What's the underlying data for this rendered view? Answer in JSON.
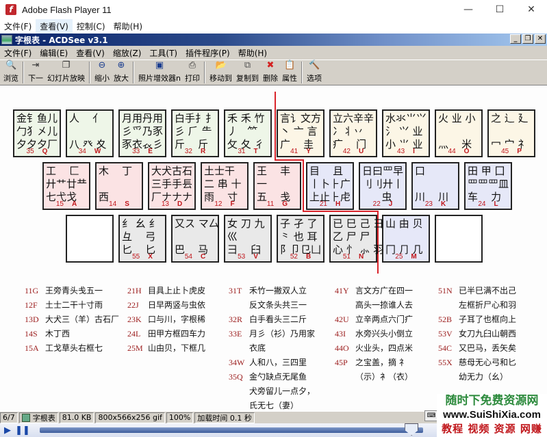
{
  "outer_window": {
    "title": "Adobe Flash Player 11",
    "menu": [
      "文件(F)",
      "查看(V)",
      "控制(C)",
      "帮助(H)"
    ],
    "active_menu_index": 1,
    "controls": {
      "minimize": "—",
      "maximize": "☐",
      "close": "✕"
    }
  },
  "acdsee": {
    "title": "字根表 - ACDSee v3.1",
    "mdi_buttons": {
      "minimize": "_",
      "restore": "❐",
      "close": "✕"
    },
    "menu": [
      "文件(F)",
      "编辑(E)",
      "查看(V)",
      "缩放(Z)",
      "工具(T)",
      "插件程序(P)",
      "帮助(H)"
    ],
    "toolbar": [
      {
        "label": "浏览",
        "icon": "🔍",
        "color": "#c9a227"
      },
      {
        "sep": true
      },
      {
        "label": "下一",
        "icon": "⇥",
        "color": "#333"
      },
      {
        "label": "幻灯片放映",
        "icon": "❐",
        "color": "#333"
      },
      {
        "sep": true
      },
      {
        "label": "缩小",
        "icon": "⊖",
        "color": "#1a3d8f"
      },
      {
        "label": "放大",
        "icon": "⊕",
        "color": "#1a3d8f"
      },
      {
        "sep": true
      },
      {
        "label": "照片增效器n",
        "icon": "▣",
        "color": "#1a3d8f"
      },
      {
        "label": "打印",
        "icon": "⎙",
        "color": "#333"
      },
      {
        "sep": true
      },
      {
        "label": "移动到",
        "icon": "📂",
        "color": "#c9a227"
      },
      {
        "label": "复制到",
        "icon": "⧉",
        "color": "#555"
      },
      {
        "label": "删除",
        "icon": "✖",
        "color": "#d42020"
      },
      {
        "label": "属性",
        "icon": "📋",
        "color": "#333"
      },
      {
        "sep": true
      },
      {
        "label": "选项",
        "icon": "🔨",
        "color": "#333"
      }
    ]
  },
  "keyboard": {
    "row1": [
      {
        "key": "Q",
        "num": "35",
        "color": "green",
        "glyphs": "金钅鱼儿\n勹犭㐅儿\n夕夕夕厂"
      },
      {
        "key": "W",
        "num": "34",
        "color": "green",
        "glyphs": "人    亻\n\n八 癶 夊"
      },
      {
        "key": "E",
        "num": "33",
        "color": "green",
        "glyphs": "月用丹用\n彡爫乃豕\n豕衣𧘇彡"
      },
      {
        "key": "R",
        "num": "32",
        "color": "green",
        "glyphs": "白手扌扌\n彡 ⺁ ⺧\n斤    斤"
      },
      {
        "key": "T",
        "num": "31",
        "color": "green",
        "glyphs": "禾 禾 竹\n丿   ⺮\n攵 夂 彳"
      },
      {
        "key": "Y",
        "num": "41",
        "color": "yellow",
        "glyphs": "言讠文方\n丶 亠 ⾔\n广    圭"
      },
      {
        "key": "U",
        "num": "42",
        "color": "yellow",
        "glyphs": "立六辛辛\n冫丬丷\n疒    门"
      },
      {
        "key": "I",
        "num": "43",
        "color": "yellow",
        "glyphs": "水氺⺌⺍\n氵 ⺍ 业\n小 ⺌ 业"
      },
      {
        "key": "O",
        "num": "44",
        "color": "yellow",
        "glyphs": "火 业 小\n\n灬    米"
      },
      {
        "key": "P",
        "num": "45",
        "color": "yellow",
        "glyphs": "之 辶 廴\n\n冖 宀 礻"
      }
    ],
    "row2": [
      {
        "key": "A",
        "num": "15",
        "color": "pink",
        "glyphs": "工    匚\n廾艹廿龷\n七弋戈"
      },
      {
        "key": "S",
        "num": "14",
        "color": "pink",
        "glyphs": "木    丁\n\n西"
      },
      {
        "key": "D",
        "num": "13",
        "color": "pink",
        "glyphs": "大犬古石\n三手手镸\n厂ナナナ"
      },
      {
        "key": "F",
        "num": "12",
        "color": "pink",
        "glyphs": "土士干\n二 串 十\n雨    寸"
      },
      {
        "key": "G",
        "num": "11",
        "color": "pink",
        "glyphs": "王    丰\n一\n五    戋"
      },
      {
        "key": "H",
        "num": "21",
        "color": "blue",
        "glyphs": "目    且\n丨卜⺊广\n上止⺊虍"
      },
      {
        "key": "J",
        "num": "22",
        "color": "blue",
        "glyphs": "日曰罒早\n刂刂廾丨\n      虫"
      },
      {
        "key": "K",
        "num": "23",
        "color": "blue",
        "glyphs": "口\n\n川    川"
      },
      {
        "key": "L",
        "num": "24",
        "color": "blue",
        "glyphs": "田 甲 囗\n罒罒罒皿\n车    力"
      }
    ],
    "row3": [
      {
        "key": "",
        "num": "",
        "color": "white",
        "glyphs": ""
      },
      {
        "key": "X",
        "num": "55",
        "color": "gray",
        "glyphs": "纟 幺 纟\n彑    弓\n匕    匕"
      },
      {
        "key": "C",
        "num": "54",
        "color": "gray",
        "glyphs": "又ス マ厶\n\n巴    马"
      },
      {
        "key": "V",
        "num": "53",
        "color": "gray",
        "glyphs": "女 刀 九\n巛\n彐    臼"
      },
      {
        "key": "B",
        "num": "52",
        "color": "gray",
        "glyphs": "子 孑 了\n⺀ 也 耳\n阝卩㔾凵"
      },
      {
        "key": "N",
        "num": "51",
        "color": "gray",
        "glyphs": "已 巳 己 ⺕\n乙 尸 尸\n心 忄 ⺗ 羽"
      },
      {
        "key": "M",
        "num": "25",
        "color": "blue",
        "glyphs": "山 由 贝\n\n冂 ⺆ 几"
      },
      {
        "key": "",
        "num": "",
        "color": "white",
        "glyphs": ""
      }
    ]
  },
  "legend": {
    "col1": [
      {
        "code": "11G",
        "text": "王旁青头戋五一"
      },
      {
        "code": "12F",
        "text": "土士二干十寸雨"
      },
      {
        "code": "13D",
        "text": "大犬三（羊）古石厂"
      },
      {
        "code": "14S",
        "text": "木丁西"
      },
      {
        "code": "15A",
        "text": "工戈草头右框七"
      }
    ],
    "col2": [
      {
        "code": "21H",
        "text": "目具上止卜虎皮"
      },
      {
        "code": "22J",
        "text": "日早两竖与虫依"
      },
      {
        "code": "23K",
        "text": "口与川，字根稀"
      },
      {
        "code": "24L",
        "text": "田甲方框四车力"
      },
      {
        "code": "25M",
        "text": "山由贝，下框几"
      }
    ],
    "col3": [
      {
        "code": "31T",
        "text": "禾竹一撇双人立"
      },
      {
        "code": "",
        "text": "反文条头共三一"
      },
      {
        "code": "32R",
        "text": "白手看头三二斤"
      },
      {
        "code": "33E",
        "text": "月彡（衫）乃用家"
      },
      {
        "code": "",
        "text": "衣底"
      },
      {
        "code": "34W",
        "text": "人和八，三四里"
      },
      {
        "code": "35Q",
        "text": "金勺缺点无尾鱼"
      },
      {
        "code": "",
        "text": "犬旁留儿一点夕，"
      },
      {
        "code": "",
        "text": "氏无七（妻）"
      }
    ],
    "col4": [
      {
        "code": "41Y",
        "text": "言文方广在四一"
      },
      {
        "code": "",
        "text": "高头一捺谁人去"
      },
      {
        "code": "42U",
        "text": "立辛两点六门疒"
      },
      {
        "code": "43I",
        "text": "水旁兴头小倒立"
      },
      {
        "code": "44O",
        "text": "火业头，四点米"
      },
      {
        "code": "45P",
        "text": "之宝盖，摘 礻"
      },
      {
        "code": "",
        "text": "（示）衤（衣）"
      }
    ],
    "col5": [
      {
        "code": "51N",
        "text": "已半巳满不出己"
      },
      {
        "code": "",
        "text": "左框折尸心和羽"
      },
      {
        "code": "52B",
        "text": "子耳了也框向上"
      },
      {
        "code": "53V",
        "text": "女刀九臼山朝西"
      },
      {
        "code": "54C",
        "text": "又巴马，丢矢矣"
      },
      {
        "code": "55X",
        "text": "慈母无心弓和匕"
      },
      {
        "code": "",
        "text": "幼无力（幺）"
      }
    ]
  },
  "statusbar": {
    "index": "6/7",
    "filename": "字根表",
    "filesize": "81.0 KB",
    "dimensions": "800x566x256 gif",
    "zoom": "100%",
    "load_time": "加载时间 0.1 秒"
  },
  "player": {
    "play": "▶",
    "pause": "❚❚",
    "progress": 0.97
  },
  "watermark": {
    "line1": "随时下免费资源网",
    "line2": "www.SuiShiXia.com",
    "line3": "教程 视频 资源 网赚"
  },
  "colors": {
    "green": "#eef6e8",
    "yellow": "#fcf6e6",
    "pink": "#fbe3e4",
    "blue": "#e6e8f8",
    "gray": "#e9e9e9",
    "white": "#ffffff",
    "code_red": "#c0151a",
    "divider_red": "#d9232a"
  }
}
